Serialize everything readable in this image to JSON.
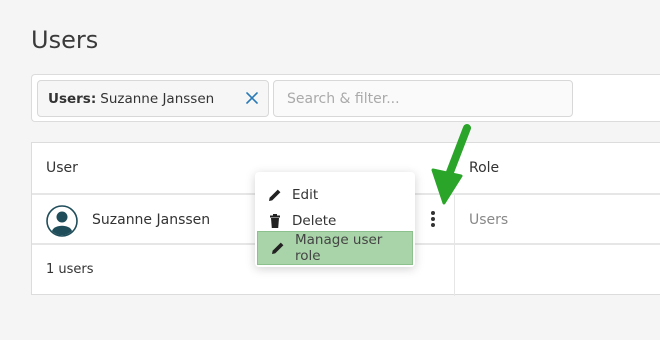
{
  "page": {
    "title": "Users"
  },
  "filter": {
    "chip_key": "Users:",
    "chip_value": "Suzanne Janssen",
    "search_placeholder": "Search & filter..."
  },
  "table": {
    "columns": {
      "user": "User",
      "role": "Role"
    },
    "rows": [
      {
        "user": "Suzanne Janssen",
        "role": "Users"
      }
    ],
    "footer": "1 users"
  },
  "context_menu": {
    "items": [
      {
        "label": "Edit",
        "icon": "pencil-icon"
      },
      {
        "label": "Delete",
        "icon": "trash-icon"
      },
      {
        "label": "Manage user role",
        "icon": "pencil-icon",
        "highlighted": true
      }
    ]
  },
  "colors": {
    "highlight": "#a9d4a9",
    "arrow": "#2aa52a",
    "chip_close": "#2a7ab8",
    "avatar": "#1f4d5a"
  }
}
